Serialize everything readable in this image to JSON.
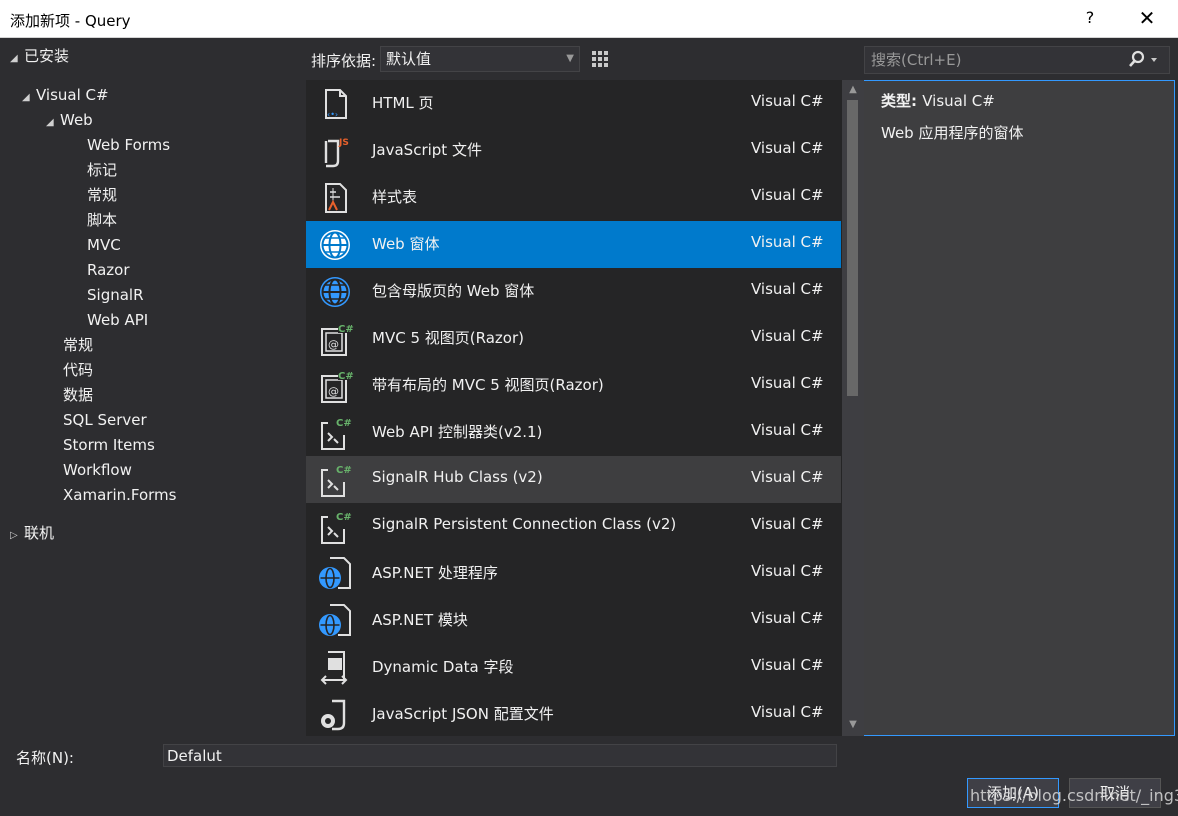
{
  "window": {
    "title": "添加新项 - Query",
    "help_label": "?",
    "close_label": "✕"
  },
  "tree": {
    "installed": "已安装",
    "visual_csharp": "Visual C#",
    "web": "Web",
    "web_children": [
      "Web Forms",
      "标记",
      "常规",
      "脚本",
      "MVC",
      "Razor",
      "SignalR",
      "Web API"
    ],
    "csharp_children": [
      "常规",
      "代码",
      "数据",
      "SQL Server",
      "Storm Items",
      "Workflow",
      "Xamarin.Forms"
    ],
    "online": "联机"
  },
  "toolbar": {
    "sort_label": "排序依据:",
    "sort_value": "默认值"
  },
  "search": {
    "placeholder": "搜索(Ctrl+E)"
  },
  "templates": [
    {
      "name": "HTML 页",
      "lang": "Visual C#",
      "icon": "html-page-icon"
    },
    {
      "name": "JavaScript 文件",
      "lang": "Visual C#",
      "icon": "javascript-file-icon"
    },
    {
      "name": "样式表",
      "lang": "Visual C#",
      "icon": "stylesheet-icon"
    },
    {
      "name": "Web 窗体",
      "lang": "Visual C#",
      "icon": "web-form-globe-icon"
    },
    {
      "name": "包含母版页的 Web 窗体",
      "lang": "Visual C#",
      "icon": "web-form-globe-icon"
    },
    {
      "name": "MVC 5 视图页(Razor)",
      "lang": "Visual C#",
      "icon": "razor-view-icon"
    },
    {
      "name": "带有布局的 MVC 5 视图页(Razor)",
      "lang": "Visual C#",
      "icon": "razor-view-icon"
    },
    {
      "name": "Web API 控制器类(v2.1)",
      "lang": "Visual C#",
      "icon": "controller-class-icon"
    },
    {
      "name": "SignalR Hub Class (v2)",
      "lang": "Visual C#",
      "icon": "signalr-class-icon"
    },
    {
      "name": "SignalR Persistent Connection Class (v2)",
      "lang": "Visual C#",
      "icon": "signalr-class-icon"
    },
    {
      "name": "ASP.NET 处理程序",
      "lang": "Visual C#",
      "icon": "aspnet-handler-icon"
    },
    {
      "name": "ASP.NET 模块",
      "lang": "Visual C#",
      "icon": "aspnet-module-icon"
    },
    {
      "name": "Dynamic Data 字段",
      "lang": "Visual C#",
      "icon": "dynamic-data-icon"
    },
    {
      "name": "JavaScript JSON 配置文件",
      "lang": "Visual C#",
      "icon": "json-config-icon"
    }
  ],
  "details": {
    "type_label": "类型:",
    "type_value": "Visual C#",
    "description": "Web 应用程序的窗体"
  },
  "footer": {
    "name_label": "名称(N):",
    "name_value": "Defalut",
    "add_label": "添加(A)",
    "cancel_label": "取消"
  },
  "watermark": "https://blog.csdn.net/_ing3",
  "colors": {
    "background": "#2d2d30",
    "list_bg": "#252526",
    "selection": "#007acc",
    "hover": "#3e3e40",
    "globe": "#3399ff",
    "csharp_badge": "#68b36b",
    "js_badge": "#e8612c"
  }
}
